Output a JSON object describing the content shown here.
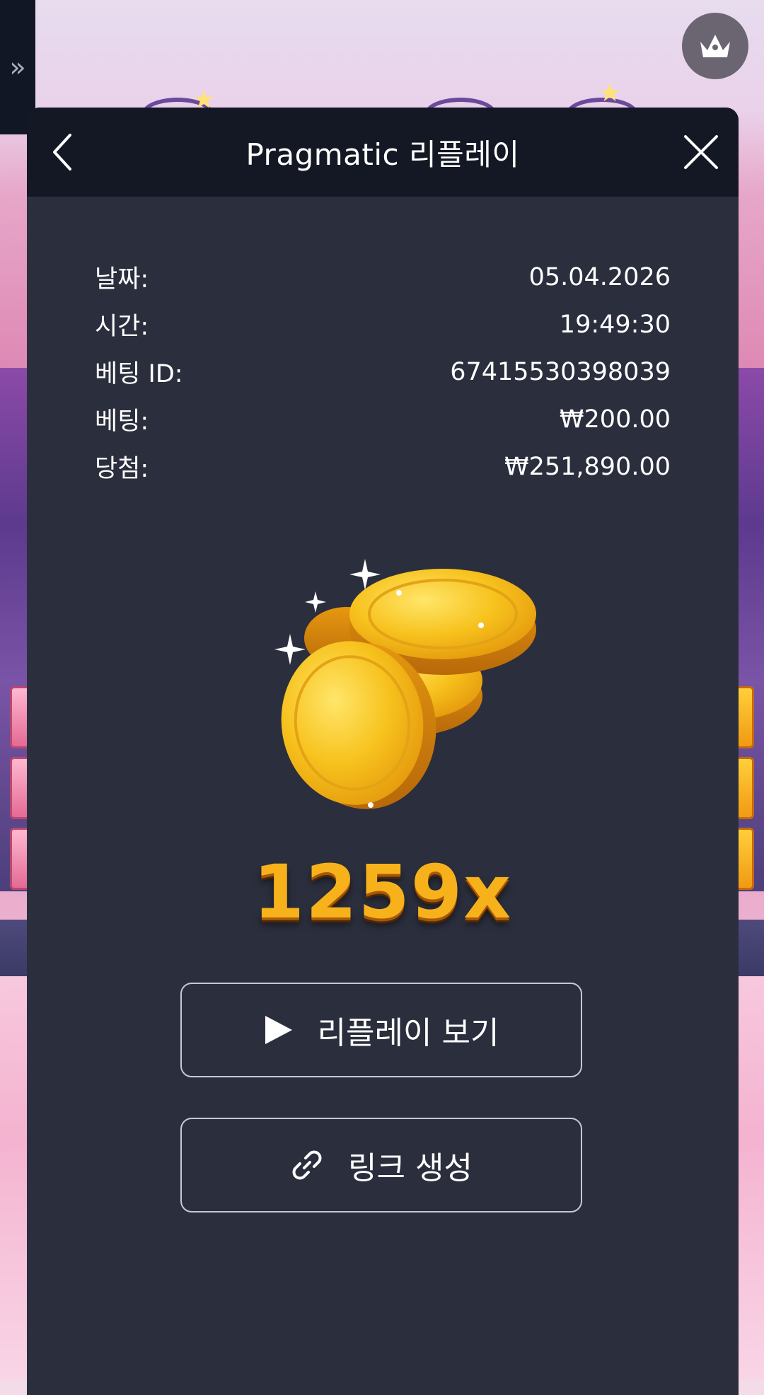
{
  "side_tab": {
    "icon": "double-chevron-right-icon",
    "glyph": "»"
  },
  "corner_badge": {
    "icon": "crown-icon"
  },
  "modal": {
    "title": "Pragmatic 리플레이",
    "back_icon": "chevron-left-icon",
    "close_icon": "close-icon"
  },
  "info": [
    {
      "label": "날짜:",
      "value": "05.04.2026"
    },
    {
      "label": "시간:",
      "value": "19:49:30"
    },
    {
      "label": "베팅 ID:",
      "value": "67415530398039"
    },
    {
      "label": "베팅:",
      "value": "₩200.00"
    },
    {
      "label": "당첨:",
      "value": "₩251,890.00"
    }
  ],
  "win_graphic": {
    "icon": "gold-coins-icon"
  },
  "multiplier": "1259x",
  "buttons": {
    "replay": {
      "label": "리플레이 보기",
      "icon": "play-icon"
    },
    "link": {
      "label": "링크 생성",
      "icon": "link-icon"
    }
  },
  "colors": {
    "modal_bg": "#2b2e3c",
    "header_bg": "#141824",
    "multiplier": "#f7b21b"
  }
}
